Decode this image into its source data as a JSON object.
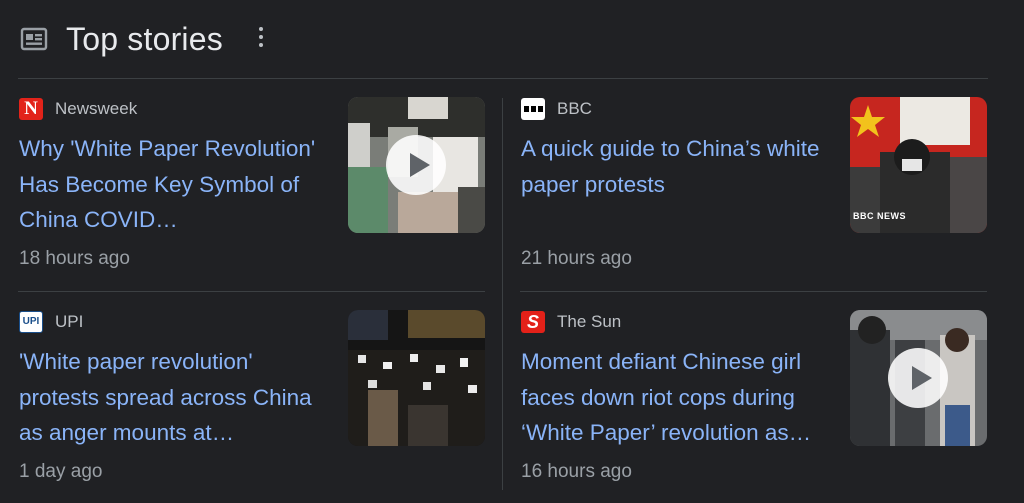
{
  "header": {
    "title": "Top stories",
    "news_icon": "newspaper-icon",
    "menu_icon": "more-vert-icon"
  },
  "colors": {
    "background": "#202124",
    "headline": "#8ab4f8",
    "meta": "#9aa0a6",
    "divider": "#3c4043"
  },
  "stories": [
    {
      "source": "Newsweek",
      "logo_text": "N",
      "headline": "Why 'White Paper Revolution' Has Become Key Symbol of China COVID…",
      "time": "18 hours ago",
      "has_video": true
    },
    {
      "source": "BBC",
      "headline": "A quick guide to China’s white paper protests",
      "time": "21 hours ago",
      "has_video": false,
      "thumb_watermark": "BBC NEWS"
    },
    {
      "source": "UPI",
      "logo_text": "UPI",
      "headline": "'White paper revolution' protests spread across China as anger mounts at…",
      "time": "1 day ago",
      "has_video": false
    },
    {
      "source": "The Sun",
      "logo_text": "S",
      "headline": "Moment defiant Chinese girl faces down riot cops during ‘White Paper’ revolution as…",
      "time": "16 hours ago",
      "has_video": true
    }
  ]
}
